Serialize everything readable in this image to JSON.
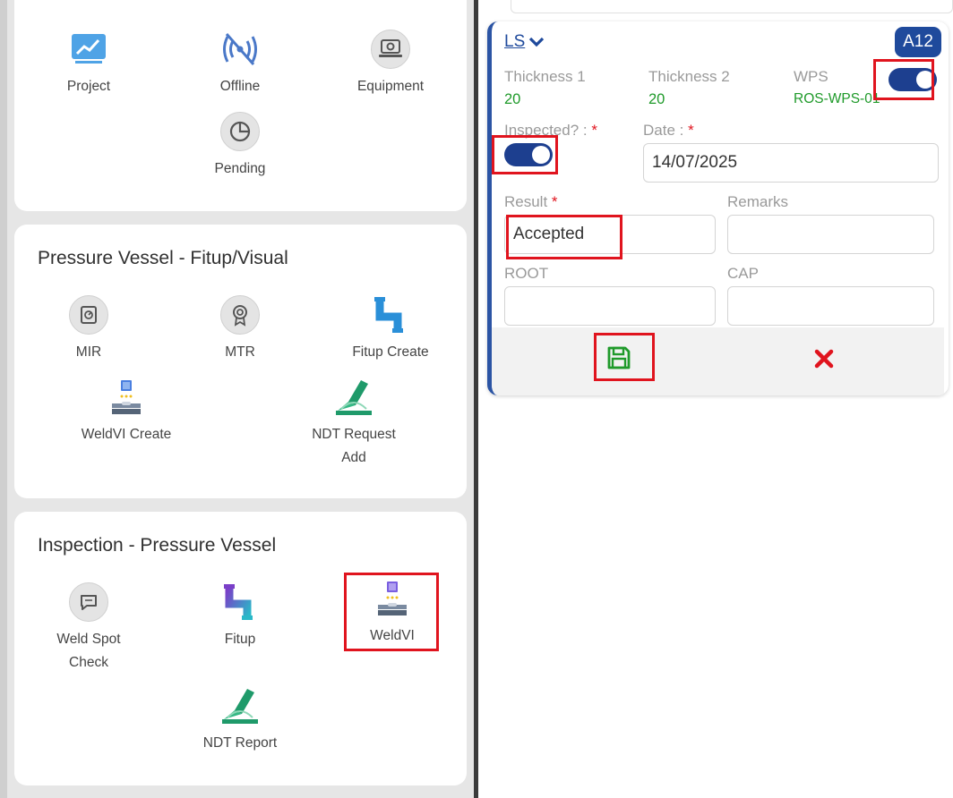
{
  "left": {
    "top_tiles": [
      {
        "label": "Project",
        "icon": "chart-board-icon"
      },
      {
        "label": "Offline",
        "icon": "offline-signal-icon"
      },
      {
        "label": "Equipment",
        "icon": "laptop-gear-icon"
      },
      {
        "label": "Pending",
        "icon": "pie-chart-icon"
      }
    ],
    "fitup_section": {
      "title": "Pressure Vessel - Fitup/Visual",
      "tiles": [
        {
          "label": "MIR",
          "icon": "meter-icon"
        },
        {
          "label": "MTR",
          "icon": "badge-certificate-icon"
        },
        {
          "label": "Fitup Create",
          "icon": "pipe-icon"
        },
        {
          "label": "WeldVI Create",
          "icon": "weld-icon"
        },
        {
          "label_line1": "NDT Request",
          "label_line2": "Add",
          "icon": "ndt-icon"
        }
      ]
    },
    "inspection_section": {
      "title": "Inspection - Pressure Vessel",
      "tiles": [
        {
          "label_line1": "Weld Spot",
          "label_line2": "Check",
          "icon": "chat-bubble-icon"
        },
        {
          "label": "Fitup",
          "icon": "pipe-icon"
        },
        {
          "label": "WeldVI",
          "icon": "weld-icon"
        },
        {
          "label": "NDT Report",
          "icon": "ndt-icon"
        }
      ]
    }
  },
  "right": {
    "ls_link": "LS",
    "badge": "A12",
    "thickness1_label": "Thickness 1",
    "thickness1_value": "20",
    "thickness2_label": "Thickness 2",
    "thickness2_value": "20",
    "wps_label": "WPS",
    "wps_value": "ROS-WPS-01",
    "wps_toggle_on": true,
    "inspected_label": "Inspected? :",
    "inspected_toggle_on": true,
    "date_label": "Date :",
    "date_value": "14/07/2025",
    "required_mark": "*",
    "result_label": "Result",
    "result_value": "Accepted",
    "remarks_label": "Remarks",
    "remarks_value": "",
    "root_label": "ROOT",
    "root_value": "",
    "cap_label": "CAP",
    "cap_value": ""
  },
  "colors": {
    "accent_blue": "#1f4a9c",
    "value_green": "#1f9a2a",
    "highlight_red": "#e0141e",
    "save_green": "#1f9a2a",
    "cancel_red": "#e0141e"
  }
}
